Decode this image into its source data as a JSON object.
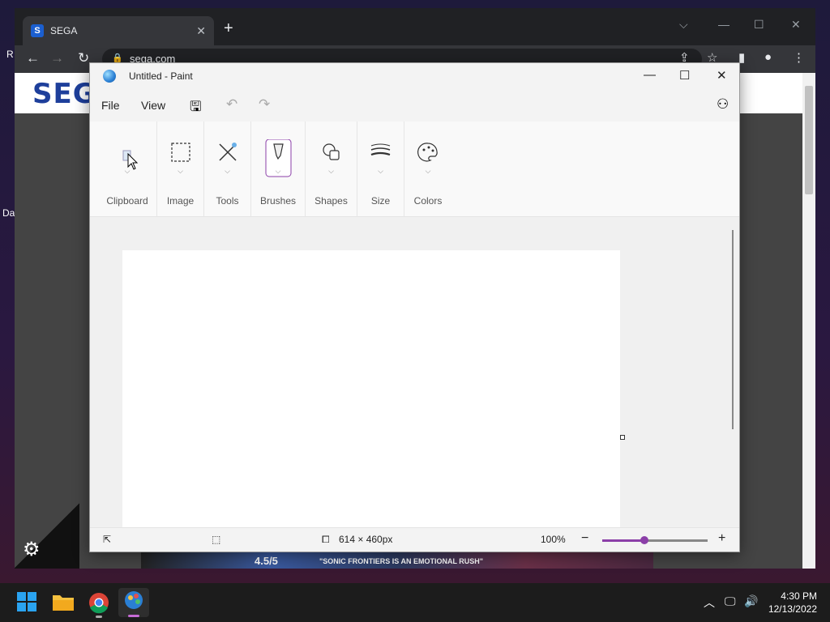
{
  "desktop": {
    "icon_fragments": [
      "R",
      "Da"
    ]
  },
  "browser": {
    "tab_title": "SEGA",
    "tab_close": "✕",
    "new_tab": "+",
    "url": "sega.com",
    "site_logo": "SEGA",
    "banner_rating": "4.5/5",
    "banner_quote": "\"SONIC FRONTIERS IS AN EMOTIONAL RUSH\""
  },
  "paint": {
    "title": "Untitled - Paint",
    "menu": {
      "file": "File",
      "view": "View"
    },
    "ribbon": [
      {
        "label": "Clipboard",
        "icon": "clipboard-icon"
      },
      {
        "label": "Image",
        "icon": "selection-icon"
      },
      {
        "label": "Tools",
        "icon": "pencil-tools-icon"
      },
      {
        "label": "Brushes",
        "icon": "brush-icon"
      },
      {
        "label": "Shapes",
        "icon": "shapes-icon"
      },
      {
        "label": "Size",
        "icon": "stroke-size-icon"
      },
      {
        "label": "Colors",
        "icon": "palette-icon"
      }
    ],
    "status": {
      "canvas_size": "614 × 460px",
      "zoom": "100%",
      "zoom_level": 0.4
    }
  },
  "taskbar": {
    "time": "4:30 PM",
    "date": "12/13/2022"
  },
  "colors": {
    "accent": "#8b3fa8",
    "sega_blue": "#1e3f9b"
  }
}
